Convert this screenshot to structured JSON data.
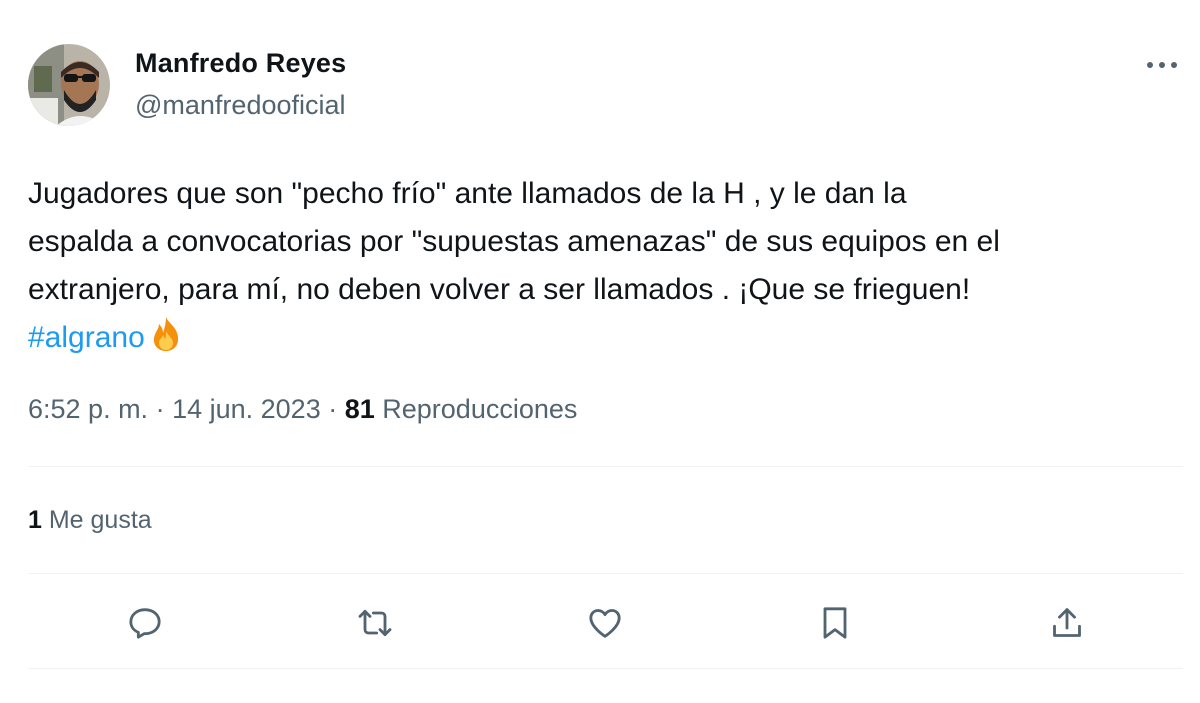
{
  "author": {
    "name": "Manfredo Reyes",
    "handle": "@manfredooficial"
  },
  "tweet": {
    "lines": [
      "Jugadores que son \"pecho frío\" ante llamados de la H , y le dan la",
      "espalda a convocatorias por \"supuestas amenazas\" de sus equipos en el",
      "extranjero, para mí, no deben volver a ser llamados . ¡Que se frieguen!"
    ],
    "hashtag": "#algrano",
    "hashtag_emoji_icon": "fire-icon"
  },
  "meta": {
    "time": "6:52 p. m.",
    "separator": " · ",
    "date": "14 jun. 2023",
    "views_count": "81",
    "views_label": " Reproducciones"
  },
  "engagement": {
    "likes_count": "1",
    "likes_label": " Me gusta"
  },
  "actions": [
    {
      "icon": "reply-icon"
    },
    {
      "icon": "retweet-icon"
    },
    {
      "icon": "like-icon"
    },
    {
      "icon": "bookmark-icon"
    },
    {
      "icon": "share-icon"
    }
  ],
  "colors": {
    "text": "#0f1419",
    "secondary": "#536471",
    "link": "#1d9bf0",
    "divider": "#eff3f4"
  }
}
